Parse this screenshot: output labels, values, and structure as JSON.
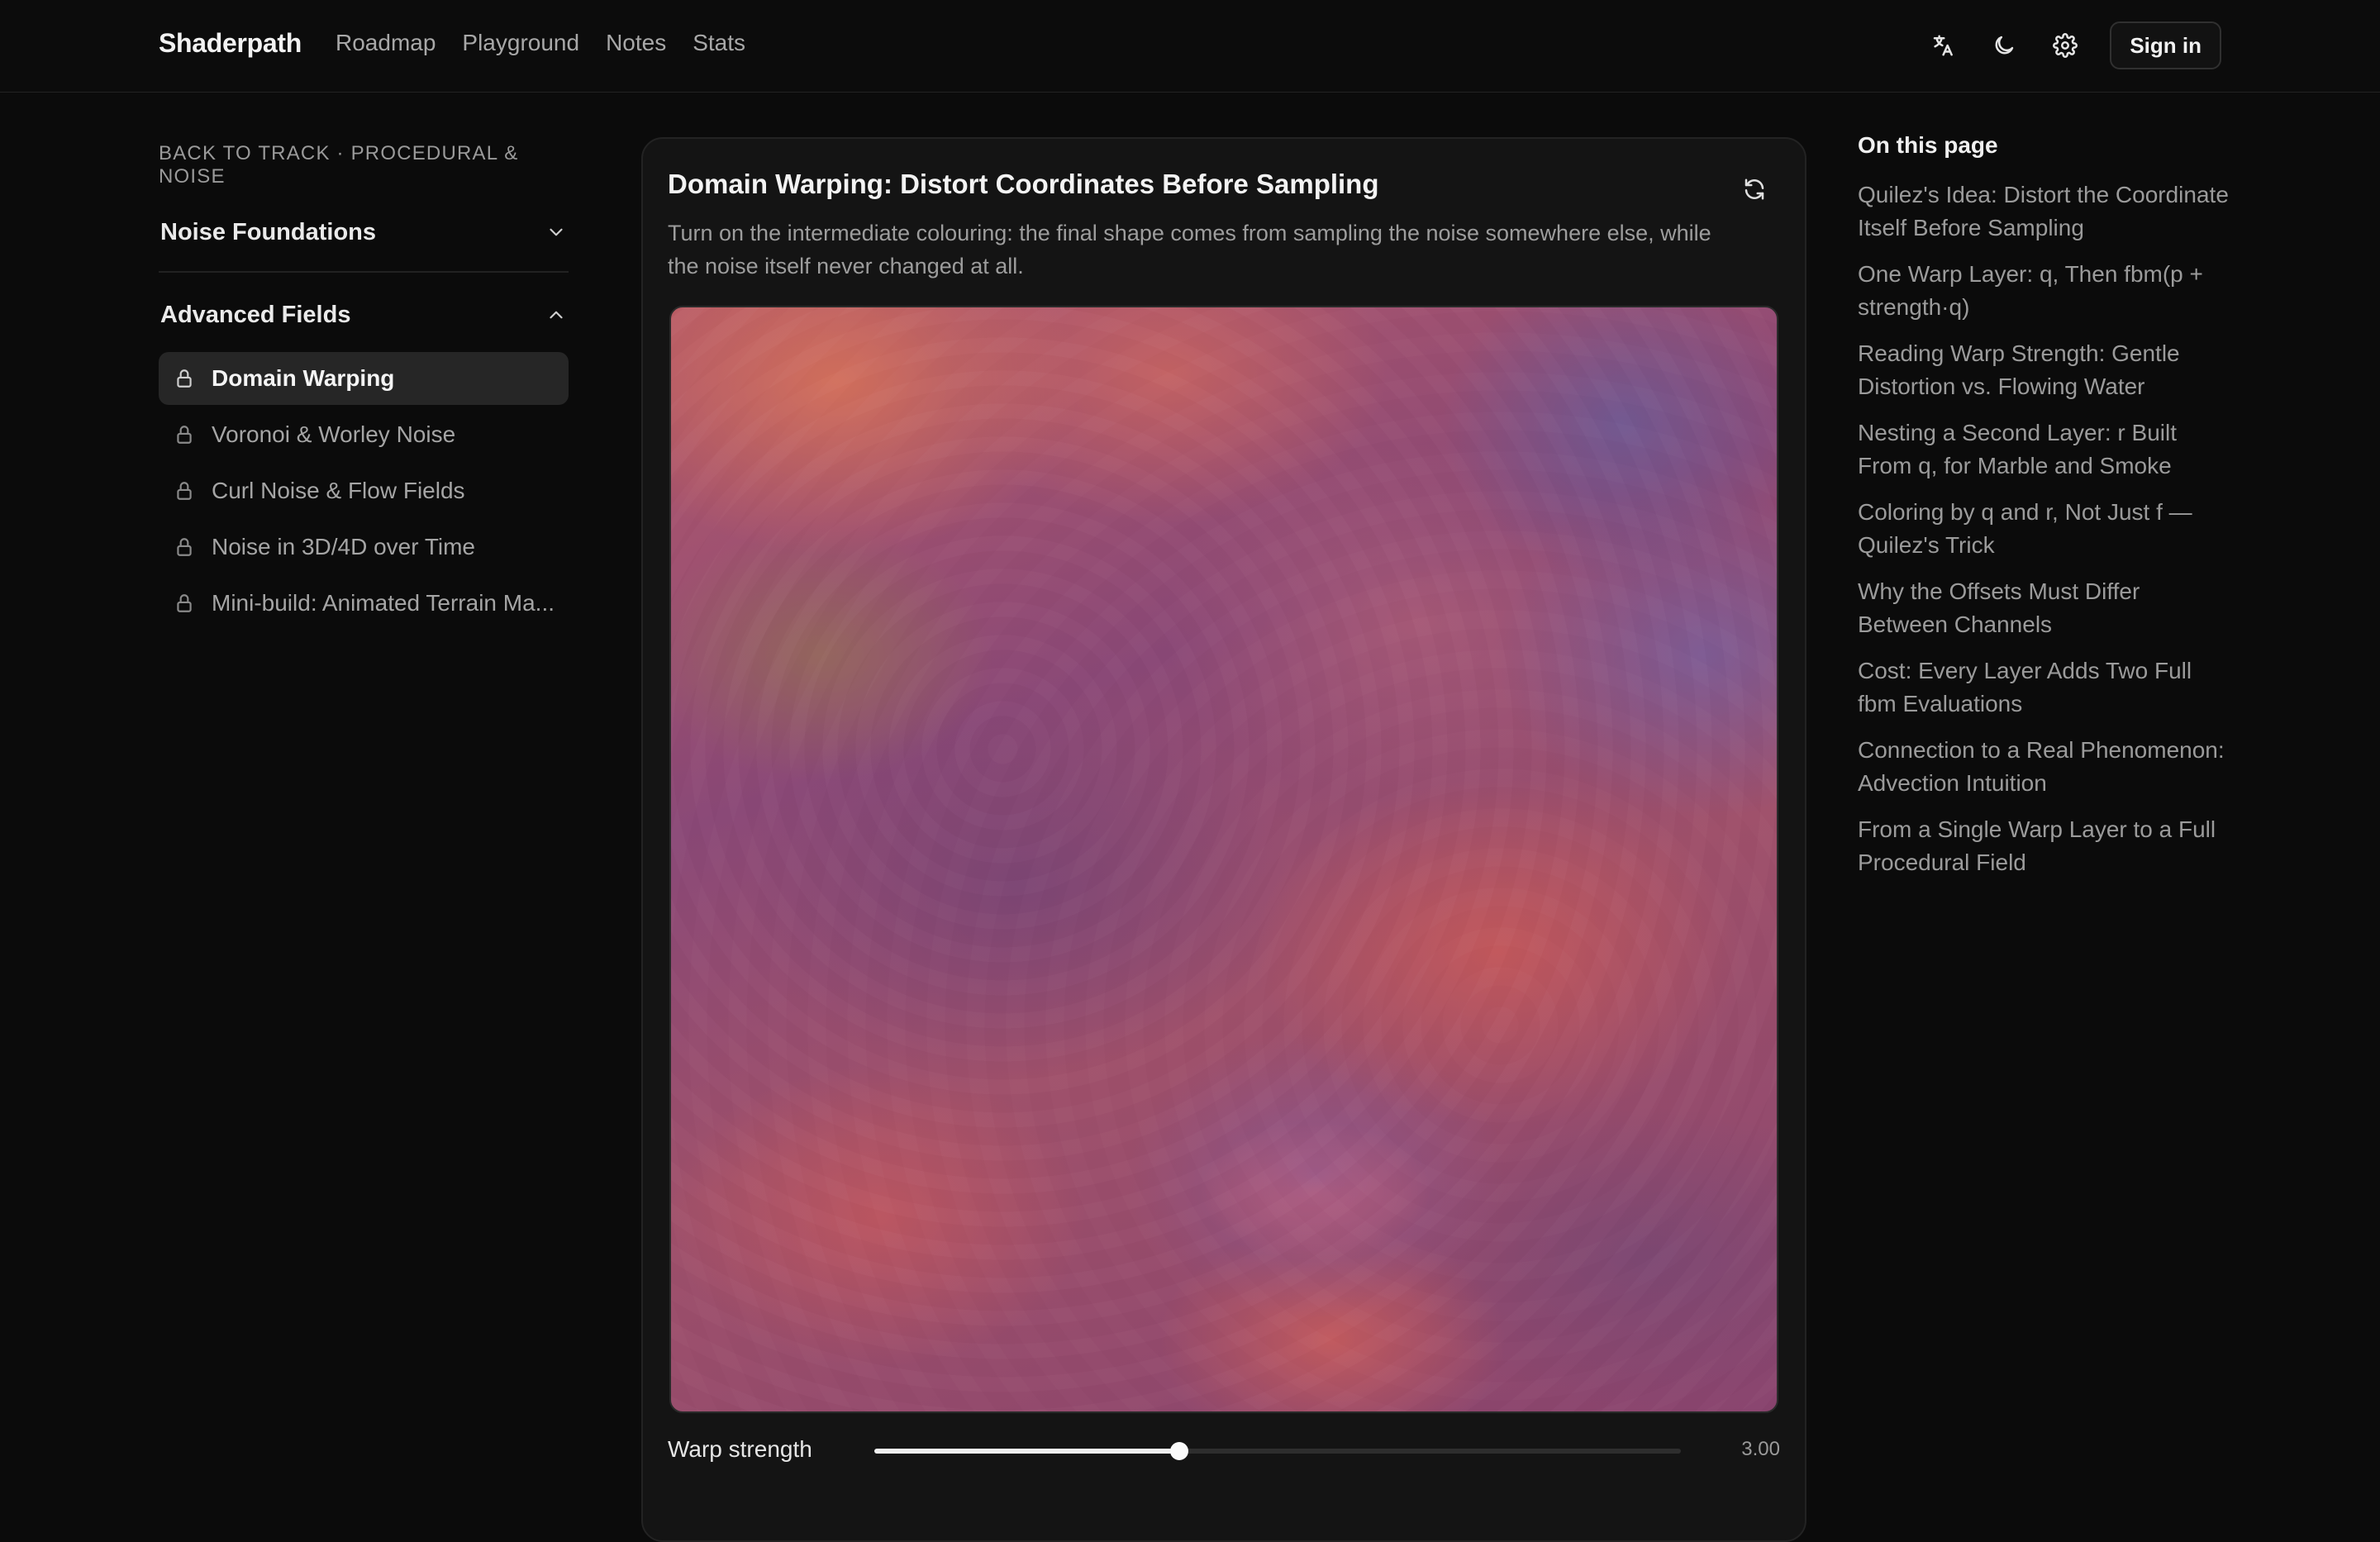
{
  "header": {
    "brand": "Shaderpath",
    "nav": [
      "Roadmap",
      "Playground",
      "Notes",
      "Stats"
    ],
    "signin_label": "Sign in"
  },
  "sidebar": {
    "back_link": "BACK TO TRACK · PROCEDURAL & NOISE",
    "sections": [
      {
        "label": "Noise Foundations",
        "expanded": false
      },
      {
        "label": "Advanced Fields",
        "expanded": true
      }
    ],
    "lessons": [
      {
        "label": "Domain Warping",
        "active": true
      },
      {
        "label": "Voronoi & Worley Noise",
        "active": false
      },
      {
        "label": "Curl Noise & Flow Fields",
        "active": false
      },
      {
        "label": "Noise in 3D/4D over Time",
        "active": false
      },
      {
        "label": "Mini-build: Animated Terrain Ma...",
        "active": false
      }
    ]
  },
  "main": {
    "title": "Domain Warping: Distort Coordinates Before Sampling",
    "description": "Turn on the intermediate colouring: the final shape comes from sampling the noise somewhere else, while the noise itself never changed at all.",
    "slider": {
      "label": "Warp strength",
      "value": 3.0,
      "value_text": "3.00",
      "fill_fraction": 0.378
    }
  },
  "toc": {
    "title": "On this page",
    "items": [
      "Quilez's Idea: Distort the Coordinate Itself Before Sampling",
      "One Warp Layer: q, Then fbm(p + strength·q)",
      "Reading Warp Strength: Gentle Distortion vs. Flowing Water",
      "Nesting a Second Layer: r Built From q, for Marble and Smoke",
      "Coloring by q and r, Not Just f — Quilez's Trick",
      "Why the Offsets Must Differ Between Channels",
      "Cost: Every Layer Adds Two Full fbm Evaluations",
      "Connection to a Real Phenomenon: Advection Intuition",
      "From a Single Warp Layer to a Full Procedural Field"
    ]
  },
  "icons": {
    "translate": "translate-icon",
    "theme": "moon-icon",
    "settings": "gear-icon",
    "refresh": "refresh-icon",
    "lock": "lock-icon",
    "chevron_down": "chevron-down-icon",
    "chevron_up": "chevron-up-icon"
  }
}
